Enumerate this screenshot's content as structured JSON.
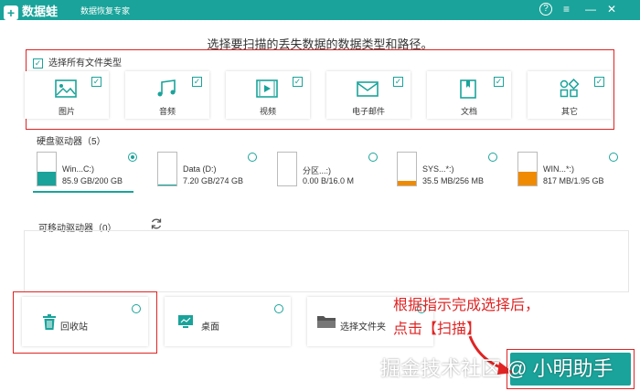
{
  "app": {
    "logo_text": "数据蛙",
    "subtitle": "数据恢复专家",
    "window_controls": {
      "help": "?",
      "menu": "≡",
      "minimize": "—",
      "close": "✕"
    }
  },
  "headline": "选择要扫描的丢失数据的数据类型和路径。",
  "select_all_label": "选择所有文件类型",
  "file_types": [
    {
      "label": "图片",
      "icon": "image-icon",
      "checked": true
    },
    {
      "label": "音频",
      "icon": "music-icon",
      "checked": true
    },
    {
      "label": "视频",
      "icon": "video-icon",
      "checked": true
    },
    {
      "label": "电子邮件",
      "icon": "email-icon",
      "checked": true
    },
    {
      "label": "文档",
      "icon": "document-icon",
      "checked": true
    },
    {
      "label": "其它",
      "icon": "other-icon",
      "checked": true
    }
  ],
  "hard_drives": {
    "label": "硬盘驱动器（5）",
    "drives": [
      {
        "name": "Win...C:)",
        "size": "85.9 GB/200 GB",
        "fill": 0.43,
        "color": "#1aa39a",
        "selected": true
      },
      {
        "name": "Data (D:)",
        "size": "7.20 GB/274 GB",
        "fill": 0.03,
        "color": "#1aa39a",
        "selected": false
      },
      {
        "name": "分区...:)",
        "size": "0.00  B/16.0 M",
        "fill": 0.0,
        "color": "#1aa39a",
        "selected": false
      },
      {
        "name": "SYS...*:)",
        "size": "35.5 MB/256 MB",
        "fill": 0.14,
        "color": "#f08a00",
        "selected": false
      },
      {
        "name": "WIN...*:)",
        "size": "817 MB/1.95 GB",
        "fill": 0.42,
        "color": "#f08a00",
        "selected": false
      }
    ]
  },
  "removable_drives": {
    "label": "可移动驱动器（0）"
  },
  "locations": [
    {
      "label": "回收站",
      "icon": "trash-icon"
    },
    {
      "label": "桌面",
      "icon": "desktop-icon"
    },
    {
      "label": "选择文件夹",
      "icon": "folder-icon"
    }
  ],
  "annotation": {
    "line1": "根据指示完成选择后，",
    "line2": "点击【扫描】"
  },
  "watermark": "掘金技术社区 @ 小明助手",
  "colors": {
    "accent": "#1aa39a",
    "annotation": "#e02424",
    "warning": "#f08a00"
  }
}
